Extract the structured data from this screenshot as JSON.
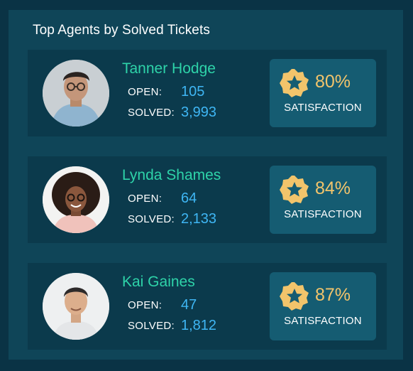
{
  "widget": {
    "title": "Top Agents by Solved Tickets"
  },
  "labels": {
    "open": "OPEN:",
    "solved": "SOLVED:",
    "satisfaction": "SATISFACTION"
  },
  "agents": [
    {
      "name": "Tanner Hodge",
      "open": "105",
      "solved": "3,993",
      "satisfaction": "80%"
    },
    {
      "name": "Lynda Shames",
      "open": "64",
      "solved": "2,133",
      "satisfaction": "84%"
    },
    {
      "name": "Kai Gaines",
      "open": "47",
      "solved": "1,812",
      "satisfaction": "87%"
    }
  ],
  "colors": {
    "background": "#0a3345",
    "panel": "#0f4558",
    "card": "#0b3a4c",
    "name": "#2ed3a9",
    "value": "#3fb6f4",
    "satisfaction_box": "#155c72",
    "satisfaction_text": "#f2c46b"
  },
  "icons": {
    "badge": "star-badge-icon"
  }
}
